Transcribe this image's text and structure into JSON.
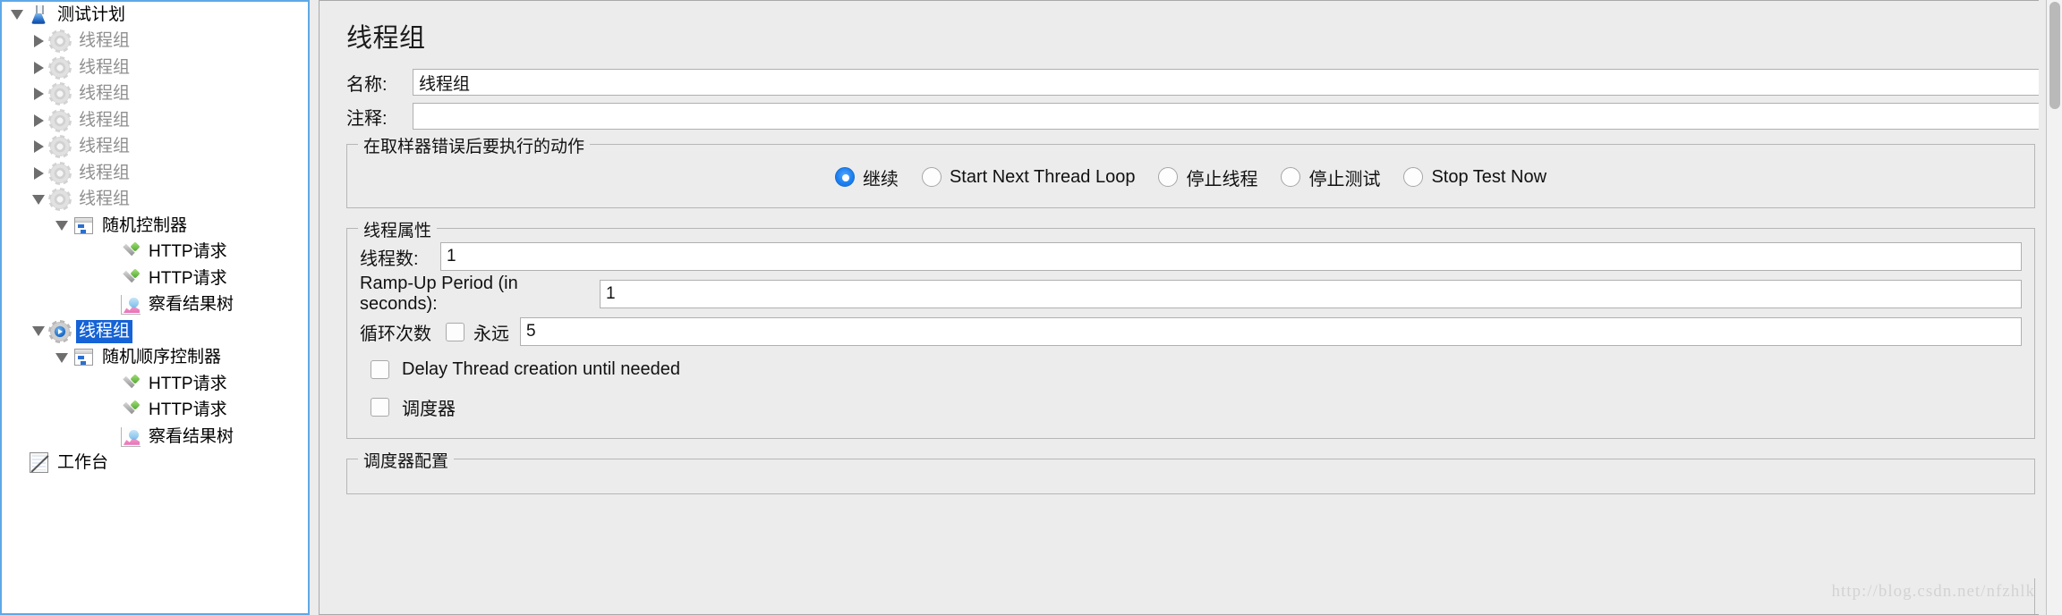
{
  "tree": {
    "nodes": [
      {
        "label": "测试计划",
        "icon": "testplan-icon",
        "indent": 0,
        "toggle": "open",
        "state": "normal"
      },
      {
        "label": "线程组",
        "icon": "gear-icon",
        "indent": 1,
        "toggle": "closed",
        "state": "disabled"
      },
      {
        "label": "线程组",
        "icon": "gear-icon",
        "indent": 1,
        "toggle": "closed",
        "state": "disabled"
      },
      {
        "label": "线程组",
        "icon": "gear-icon",
        "indent": 1,
        "toggle": "closed",
        "state": "disabled"
      },
      {
        "label": "线程组",
        "icon": "gear-icon",
        "indent": 1,
        "toggle": "closed",
        "state": "disabled"
      },
      {
        "label": "线程组",
        "icon": "gear-icon",
        "indent": 1,
        "toggle": "closed",
        "state": "disabled"
      },
      {
        "label": "线程组",
        "icon": "gear-icon",
        "indent": 1,
        "toggle": "closed",
        "state": "disabled"
      },
      {
        "label": "线程组",
        "icon": "gear-icon",
        "indent": 1,
        "toggle": "open",
        "state": "disabled"
      },
      {
        "label": "随机控制器",
        "icon": "controller-icon",
        "indent": 2,
        "toggle": "open",
        "state": "normal"
      },
      {
        "label": "HTTP请求",
        "icon": "http-request-icon",
        "indent": 3,
        "toggle": "none",
        "state": "normal"
      },
      {
        "label": "HTTP请求",
        "icon": "http-request-icon",
        "indent": 3,
        "toggle": "none",
        "state": "normal"
      },
      {
        "label": "察看结果树",
        "icon": "view-results-tree-icon",
        "indent": 3,
        "toggle": "none",
        "state": "normal"
      },
      {
        "label": "线程组",
        "icon": "gear-active-icon",
        "indent": 1,
        "toggle": "open",
        "state": "selected"
      },
      {
        "label": "随机顺序控制器",
        "icon": "controller-icon",
        "indent": 2,
        "toggle": "open",
        "state": "normal"
      },
      {
        "label": "HTTP请求",
        "icon": "http-request-icon",
        "indent": 3,
        "toggle": "none",
        "state": "normal"
      },
      {
        "label": "HTTP请求",
        "icon": "http-request-icon",
        "indent": 3,
        "toggle": "none",
        "state": "normal"
      },
      {
        "label": "察看结果树",
        "icon": "view-results-tree-icon",
        "indent": 3,
        "toggle": "none",
        "state": "normal"
      },
      {
        "label": "工作台",
        "icon": "workbench-icon",
        "indent": 0,
        "toggle": "none",
        "state": "normal"
      }
    ]
  },
  "panel": {
    "title": "线程组",
    "name_label": "名称:",
    "name_value": "线程组",
    "comment_label": "注释:",
    "comment_value": "",
    "error_action": {
      "legend": "在取样器错误后要执行的动作",
      "options": [
        {
          "label": "继续",
          "selected": true
        },
        {
          "label": "Start Next Thread Loop",
          "selected": false
        },
        {
          "label": "停止线程",
          "selected": false
        },
        {
          "label": "停止测试",
          "selected": false
        },
        {
          "label": "Stop Test Now",
          "selected": false
        }
      ]
    },
    "thread_properties": {
      "legend": "线程属性",
      "thread_count_label": "线程数:",
      "thread_count_value": "1",
      "ramp_up_label": "Ramp-Up Period (in seconds):",
      "ramp_up_value": "1",
      "loop_count_label": "循环次数",
      "forever_label": "永远",
      "forever_checked": false,
      "loop_count_value": "5",
      "delay_thread_label": "Delay Thread creation until needed",
      "delay_thread_checked": false,
      "scheduler_label": "调度器",
      "scheduler_checked": false
    },
    "scheduler_config": {
      "legend": "调度器配置"
    }
  },
  "watermark": "http://blog.csdn.net/nfzhlk",
  "colors": {
    "selection_blue": "#1563d6",
    "panel_border_blue": "#5fa8e8",
    "radio_blue": "#1a7ef0",
    "background": "#ececec"
  }
}
